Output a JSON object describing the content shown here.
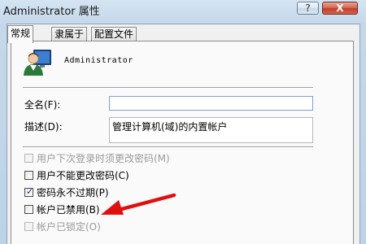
{
  "window": {
    "title": "Administrator 属性",
    "help_button": "?",
    "close_button": "X"
  },
  "tabs": [
    {
      "label": "常规",
      "active": true
    },
    {
      "label": "隶属于",
      "active": false
    },
    {
      "label": "配置文件",
      "active": false
    }
  ],
  "user": {
    "name": "Administrator",
    "icon": "user-icon"
  },
  "fields": {
    "full_name_label": "全名(F):",
    "full_name_value": "",
    "description_label": "描述(D):",
    "description_value": "管理计算机(域)的内置帐户"
  },
  "options": [
    {
      "label": "用户下次登录时须更改密码(M)",
      "checked": false,
      "enabled": false
    },
    {
      "label": "用户不能更改密码(C)",
      "checked": false,
      "enabled": true
    },
    {
      "label": "密码永不过期(P)",
      "checked": true,
      "enabled": true
    },
    {
      "label": "帐户已禁用(B)",
      "checked": false,
      "enabled": true
    },
    {
      "label": "帐户已锁定(O)",
      "checked": false,
      "enabled": false
    }
  ],
  "annotation": {
    "icon": "red-arrow-icon",
    "color": "#e01010"
  },
  "colors": {
    "close_button": "#c13c28",
    "focus_border": "#7da2ce"
  }
}
